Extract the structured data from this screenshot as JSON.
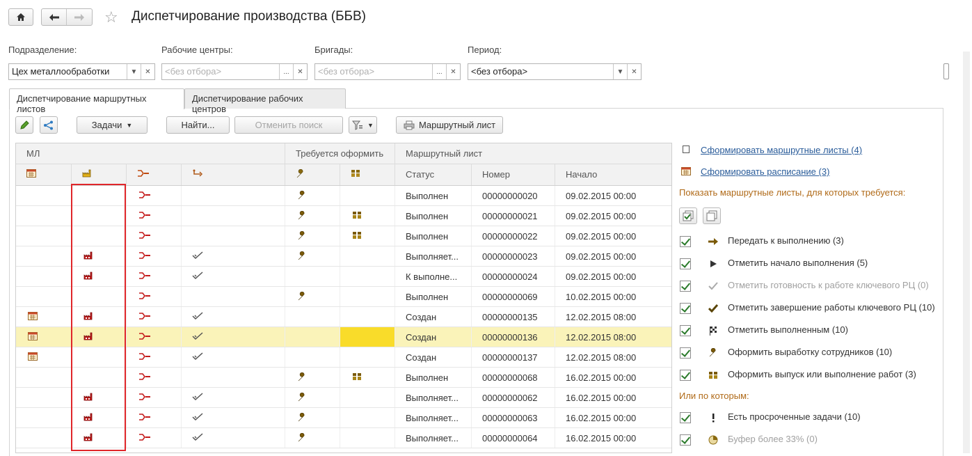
{
  "window": {
    "title": "Диспетчирование производства (ББВ)"
  },
  "filters": {
    "subdivision": {
      "label": "Подразделение:",
      "value": "Цех металлообработки"
    },
    "work_centers": {
      "label": "Рабочие центры:",
      "placeholder": "<без отбора>"
    },
    "brigades": {
      "label": "Бригады:",
      "placeholder": "<без отбора>"
    },
    "period": {
      "label": "Период:",
      "value": "<без отбора>"
    }
  },
  "tabs": [
    {
      "label": "Диспетчирование маршрутных листов"
    },
    {
      "label": "Диспетчирование рабочих центров"
    }
  ],
  "toolbar": {
    "tasks_label": "Задачи",
    "find_label": "Найти...",
    "cancel_search_label": "Отменить поиск",
    "route_sheet_label": "Маршрутный лист"
  },
  "grid": {
    "group_headers": {
      "ml": "МЛ",
      "requires": "Требуется оформить",
      "route_sheet": "Маршрутный лист"
    },
    "columns": {
      "status": "Статус",
      "number": "Номер",
      "start": "Начало"
    },
    "rows": [
      {
        "cal": false,
        "fac": false,
        "wc": true,
        "chk": false,
        "wrench": true,
        "people": false,
        "status": "Выполнен",
        "number": "00000000020",
        "start": "09.02.2015 00:00"
      },
      {
        "cal": false,
        "fac": false,
        "wc": true,
        "chk": false,
        "wrench": true,
        "people": true,
        "status": "Выполнен",
        "number": "00000000021",
        "start": "09.02.2015 00:00"
      },
      {
        "cal": false,
        "fac": false,
        "wc": true,
        "chk": false,
        "wrench": true,
        "people": true,
        "status": "Выполнен",
        "number": "00000000022",
        "start": "09.02.2015 00:00"
      },
      {
        "cal": false,
        "fac": true,
        "wc": true,
        "chk": true,
        "wrench": true,
        "people": false,
        "status": "Выполняет...",
        "number": "00000000023",
        "start": "09.02.2015 00:00"
      },
      {
        "cal": false,
        "fac": true,
        "wc": true,
        "chk": true,
        "wrench": false,
        "people": false,
        "status": "К выполне...",
        "number": "00000000024",
        "start": "09.02.2015 00:00"
      },
      {
        "cal": false,
        "fac": false,
        "wc": true,
        "chk": false,
        "wrench": true,
        "people": false,
        "status": "Выполнен",
        "number": "00000000069",
        "start": "10.02.2015 00:00"
      },
      {
        "cal": true,
        "fac": true,
        "wc": true,
        "chk": true,
        "wrench": false,
        "people": false,
        "status": "Создан",
        "number": "00000000135",
        "start": "12.02.2015 08:00"
      },
      {
        "cal": true,
        "fac": true,
        "wc": true,
        "chk": true,
        "wrench": false,
        "people": false,
        "status": "Создан",
        "number": "00000000136",
        "start": "12.02.2015 08:00",
        "selected": true
      },
      {
        "cal": true,
        "fac": false,
        "wc": true,
        "chk": true,
        "wrench": false,
        "people": false,
        "status": "Создан",
        "number": "00000000137",
        "start": "12.02.2015 08:00"
      },
      {
        "cal": false,
        "fac": false,
        "wc": true,
        "chk": false,
        "wrench": true,
        "people": true,
        "status": "Выполнен",
        "number": "00000000068",
        "start": "16.02.2015 00:00"
      },
      {
        "cal": false,
        "fac": true,
        "wc": true,
        "chk": true,
        "wrench": true,
        "people": false,
        "status": "Выполняет...",
        "number": "00000000062",
        "start": "16.02.2015 00:00"
      },
      {
        "cal": false,
        "fac": true,
        "wc": true,
        "chk": true,
        "wrench": true,
        "people": false,
        "status": "Выполняет...",
        "number": "00000000063",
        "start": "16.02.2015 00:00"
      },
      {
        "cal": false,
        "fac": true,
        "wc": true,
        "chk": true,
        "wrench": true,
        "people": false,
        "status": "Выполняет...",
        "number": "00000000064",
        "start": "16.02.2015 00:00"
      }
    ]
  },
  "right_panel": {
    "link_form_sheets": "Сформировать маршрутные листы (4)",
    "link_form_schedule": "Сформировать расписание (3)",
    "show_heading": "Показать маршрутные листы, для которых требуется:",
    "filters": [
      {
        "label": "Передать к выполнению (3)",
        "icon": "arrow-right-icon",
        "disabled": false
      },
      {
        "label": "Отметить начало выполнения (5)",
        "icon": "play-icon",
        "disabled": false
      },
      {
        "label": "Отметить готовность к работе ключевого РЦ (0)",
        "icon": "checkmark-light-icon",
        "disabled": true
      },
      {
        "label": "Отметить завершение работы ключевого РЦ (10)",
        "icon": "checkmark-bold-icon",
        "disabled": false
      },
      {
        "label": "Отметить выполненным (10)",
        "icon": "finish-flag-icon",
        "disabled": false
      },
      {
        "label": "Оформить выработку сотрудников (10)",
        "icon": "wrench-icon",
        "disabled": false
      },
      {
        "label": "Оформить выпуск или выполнение работ (3)",
        "icon": "people-icon",
        "disabled": false
      }
    ],
    "or_heading": "Или по которым:",
    "or_filters": [
      {
        "label": "Есть просроченные задачи (10)",
        "icon": "exclamation-icon",
        "disabled": false
      },
      {
        "label": "Буфер более 33% (0)",
        "icon": "pie-icon",
        "disabled": true
      }
    ]
  }
}
